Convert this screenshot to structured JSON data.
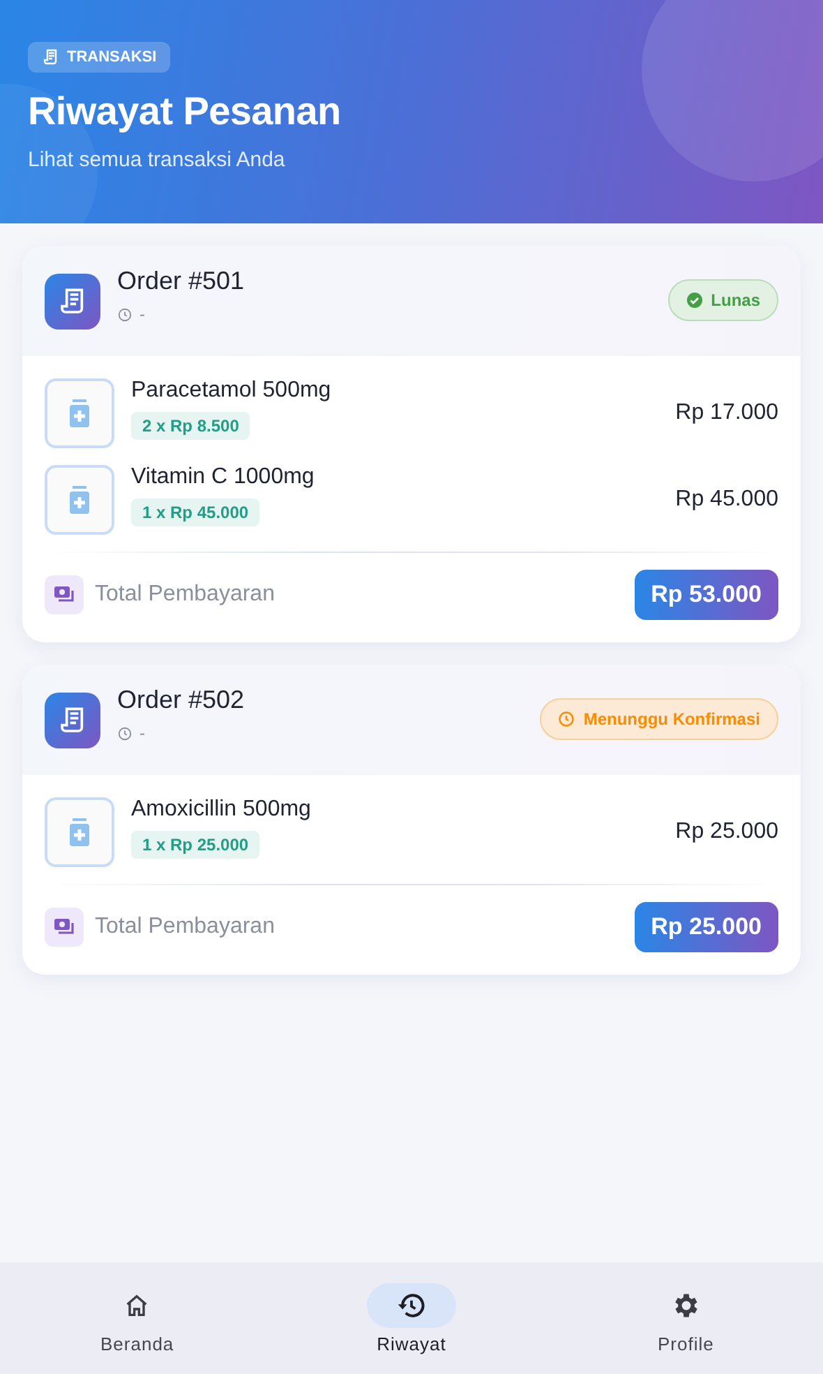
{
  "header": {
    "badge": "TRANSAKSI",
    "title": "Riwayat Pesanan",
    "subtitle": "Lihat semua transaksi Anda"
  },
  "orders": [
    {
      "title": "Order #501",
      "time": "-",
      "status": {
        "kind": "paid",
        "label": "Lunas"
      },
      "items": [
        {
          "name": "Paracetamol 500mg",
          "qty": "2 x Rp 8.500",
          "subtotal": "Rp 17.000"
        },
        {
          "name": "Vitamin C 1000mg",
          "qty": "1 x Rp 45.000",
          "subtotal": "Rp 45.000"
        }
      ],
      "total_label": "Total Pembayaran",
      "total": "Rp 53.000"
    },
    {
      "title": "Order #502",
      "time": "-",
      "status": {
        "kind": "pending",
        "label": "Menunggu Konfirmasi"
      },
      "items": [
        {
          "name": "Amoxicillin 500mg",
          "qty": "1 x Rp 25.000",
          "subtotal": "Rp 25.000"
        }
      ],
      "total_label": "Total Pembayaran",
      "total": "Rp 25.000"
    }
  ],
  "nav": [
    {
      "kind": "home",
      "label": "Beranda",
      "selected": false
    },
    {
      "kind": "history",
      "label": "Riwayat",
      "selected": true
    },
    {
      "kind": "settings",
      "label": "Profile",
      "selected": false
    }
  ]
}
